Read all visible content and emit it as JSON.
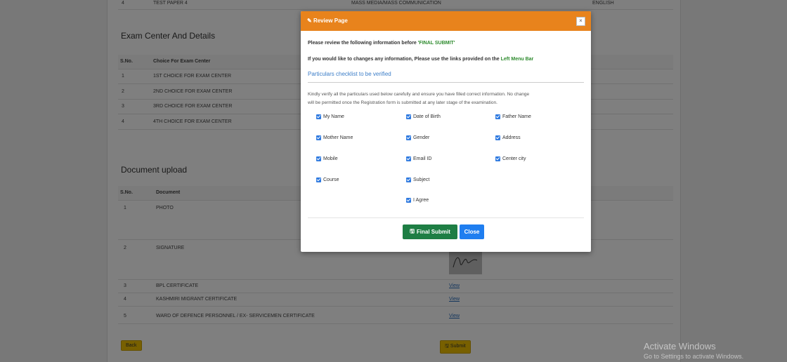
{
  "background_page": {
    "top_row": {
      "sno": "4",
      "paper": "TEST PAPER 4",
      "subject": "MASS MEDIA/MASS COMMUNICATION",
      "medium": "ENGLISH"
    },
    "exam_center": {
      "title": "Exam Center And Details",
      "headers": [
        "S.No.",
        "Choice For Exam Center"
      ],
      "rows": [
        {
          "sno": "1",
          "choice": "1ST CHOICE FOR EXAM CENTER"
        },
        {
          "sno": "2",
          "choice": "2ND CHOICE FOR EXAM CENTER"
        },
        {
          "sno": "3",
          "choice": "3RD CHOICE FOR EXAM CENTER"
        },
        {
          "sno": "4",
          "choice": "4TH CHOICE FOR EXAM CENTER"
        }
      ]
    },
    "document_upload": {
      "title": "Document upload",
      "headers": [
        "S.No.",
        "Document"
      ],
      "rows": [
        {
          "sno": "1",
          "document": "PHOTO",
          "link": ""
        },
        {
          "sno": "2",
          "document": "SIGNATURE",
          "link": ""
        },
        {
          "sno": "3",
          "document": "BPL CERTIFICATE",
          "link": "View"
        },
        {
          "sno": "4",
          "document": "KASHMIRI MIGRANT CERTIFICATE",
          "link": "View"
        },
        {
          "sno": "5",
          "document": "WARD OF DEFENCE PERSONNEL / EX- SERVICEMEN CERTIFICATE",
          "link": "View"
        }
      ]
    },
    "back_label": "Back",
    "submit_label": "Submit"
  },
  "watermark": {
    "line1": "Activate Windows",
    "line2": "Go to Settings to activate Windows."
  },
  "modal": {
    "title": "Review Page",
    "close_symbol": "×",
    "line1_pre": "Please review the following information before ",
    "line1_em": "'FINAL SUBMIT'",
    "line2_pre": "If you would like to changes any information, Please use the links provided on the ",
    "line2_link": "Left Menu Bar",
    "checklist_title": "Particulars checklist to be verified",
    "notice_line1": "Kindly verify all the particulars used below carefully and ensure you have filled correct information. No change",
    "notice_line2": "will be permitted once the Registration form is submitted at any later stage of the examination.",
    "checks": [
      "My Name",
      "Date of Birth",
      "Father Name",
      "Mother Name",
      "Gender",
      "Address",
      "Mobile",
      "Email ID",
      "Center city",
      "Course",
      "Subject",
      "I Agree"
    ],
    "final_submit_label": "Final Submit",
    "close_label": "Close"
  }
}
